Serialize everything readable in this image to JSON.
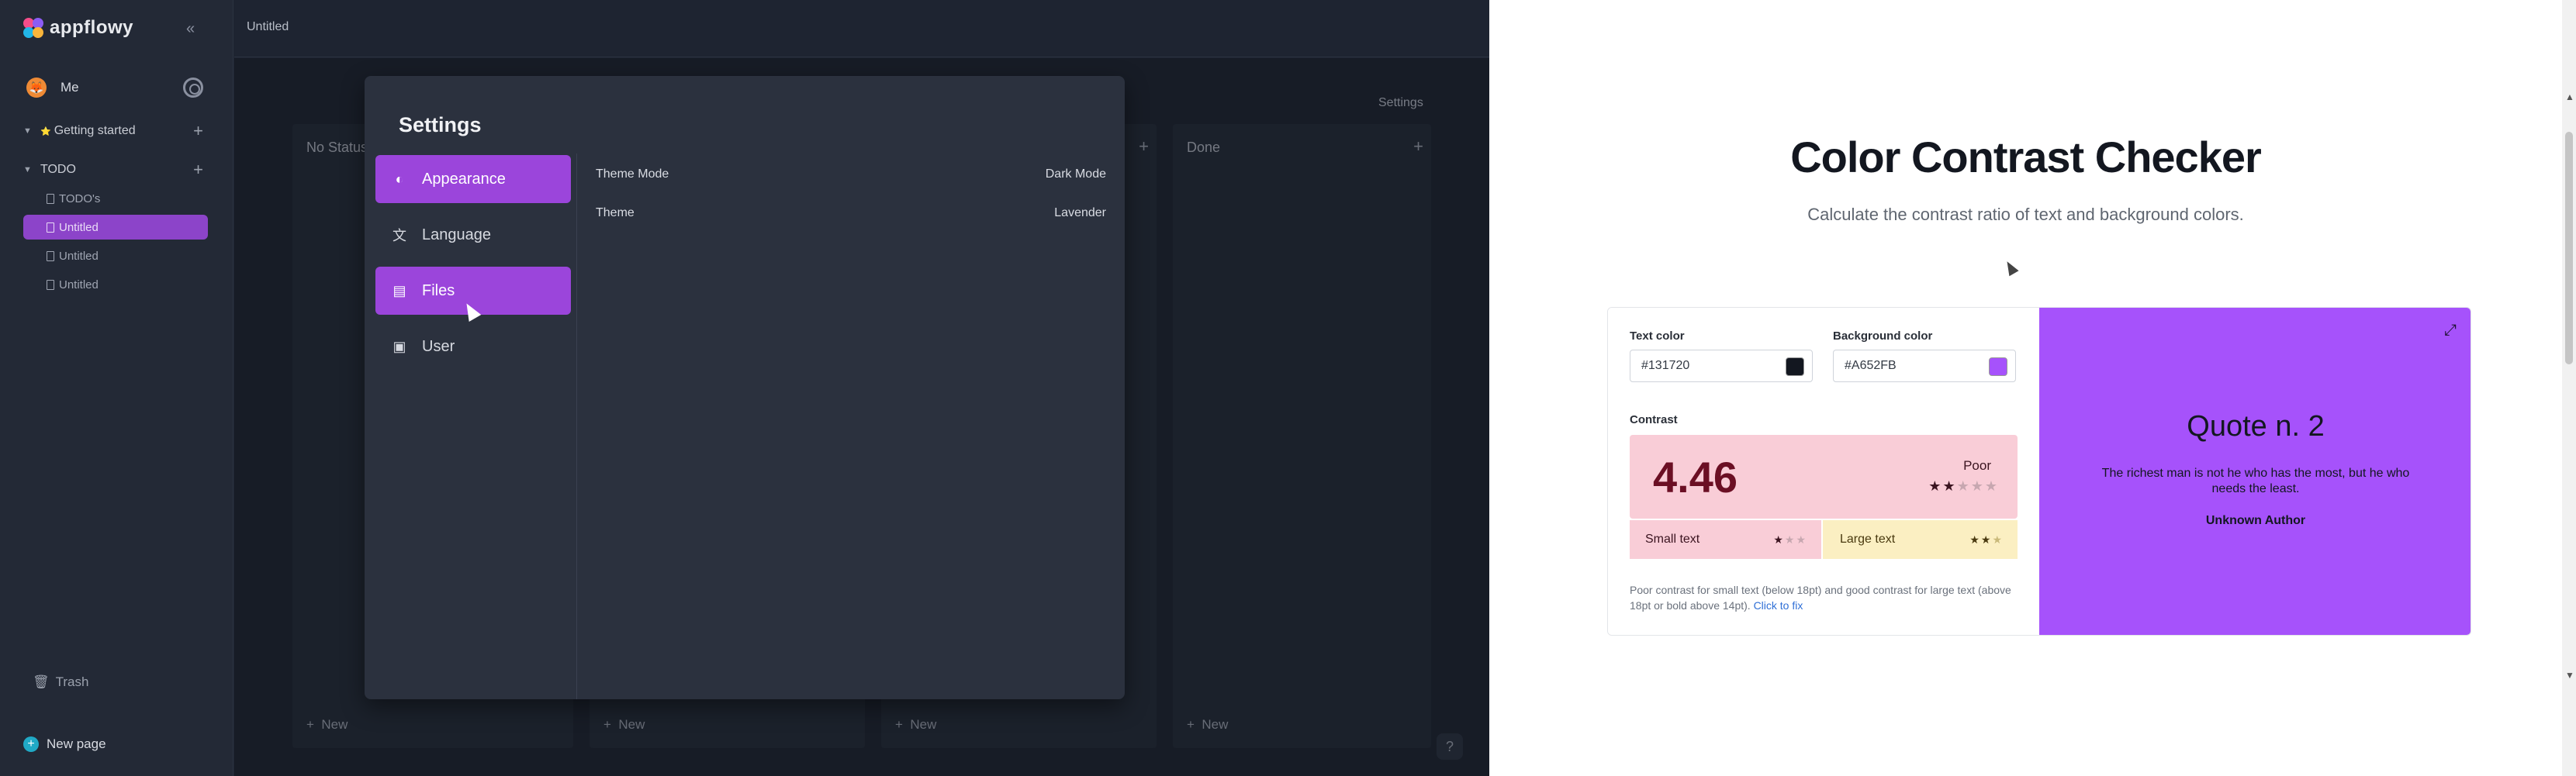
{
  "app": {
    "logo": "appflowy",
    "user": {
      "avatar_glyph": "🦊",
      "name": "Me"
    },
    "sections": [
      {
        "label": "Getting started",
        "prefix": "⭐"
      },
      {
        "label": "TODO"
      }
    ],
    "pages": [
      {
        "label": "TODO's"
      },
      {
        "label": "Untitled",
        "selected": true
      },
      {
        "label": "Untitled"
      },
      {
        "label": "Untitled"
      }
    ],
    "trash": "Trash",
    "new_page": "New page",
    "breadcrumb": "Untitled",
    "settings_tab": "Settings",
    "columns": [
      {
        "title": "No Status",
        "new": "New"
      },
      {
        "title": "",
        "new": "New"
      },
      {
        "title": "",
        "new": "New"
      },
      {
        "title": "Done",
        "new": "New"
      }
    ],
    "help": "?"
  },
  "settings": {
    "title": "Settings",
    "nav": [
      {
        "label": "Appearance",
        "icon": "appearance-icon",
        "active": true
      },
      {
        "label": "Language",
        "icon": "language-icon",
        "active": false
      },
      {
        "label": "Files",
        "icon": "file-icon",
        "active": true
      },
      {
        "label": "User",
        "icon": "user-icon",
        "active": false
      }
    ],
    "options": [
      {
        "label": "Theme Mode",
        "value": "Dark Mode"
      },
      {
        "label": "Theme",
        "value": "Lavender"
      }
    ],
    "accent": "#9b45db"
  },
  "checker": {
    "title": "Color Contrast Checker",
    "subtitle": "Calculate the contrast ratio of text and background colors.",
    "text_color_label": "Text color",
    "text_color": "#131720",
    "background_color_label": "Background color",
    "background_color": "#A652FB",
    "contrast_label": "Contrast",
    "ratio": "4.46",
    "grade": "Poor",
    "grade_stars": 2,
    "small_text_label": "Small text",
    "small_text_stars": 1,
    "large_text_label": "Large text",
    "large_text_stars": 2,
    "note": "Poor contrast for small text (below 18pt) and good contrast for large text (above 18pt or bold above 14pt).",
    "fix_link": "Click to fix",
    "preview": {
      "title": "Quote n. 2",
      "body": "The richest man is not he who has the most, but he who needs the least.",
      "author": "Unknown Author"
    }
  }
}
